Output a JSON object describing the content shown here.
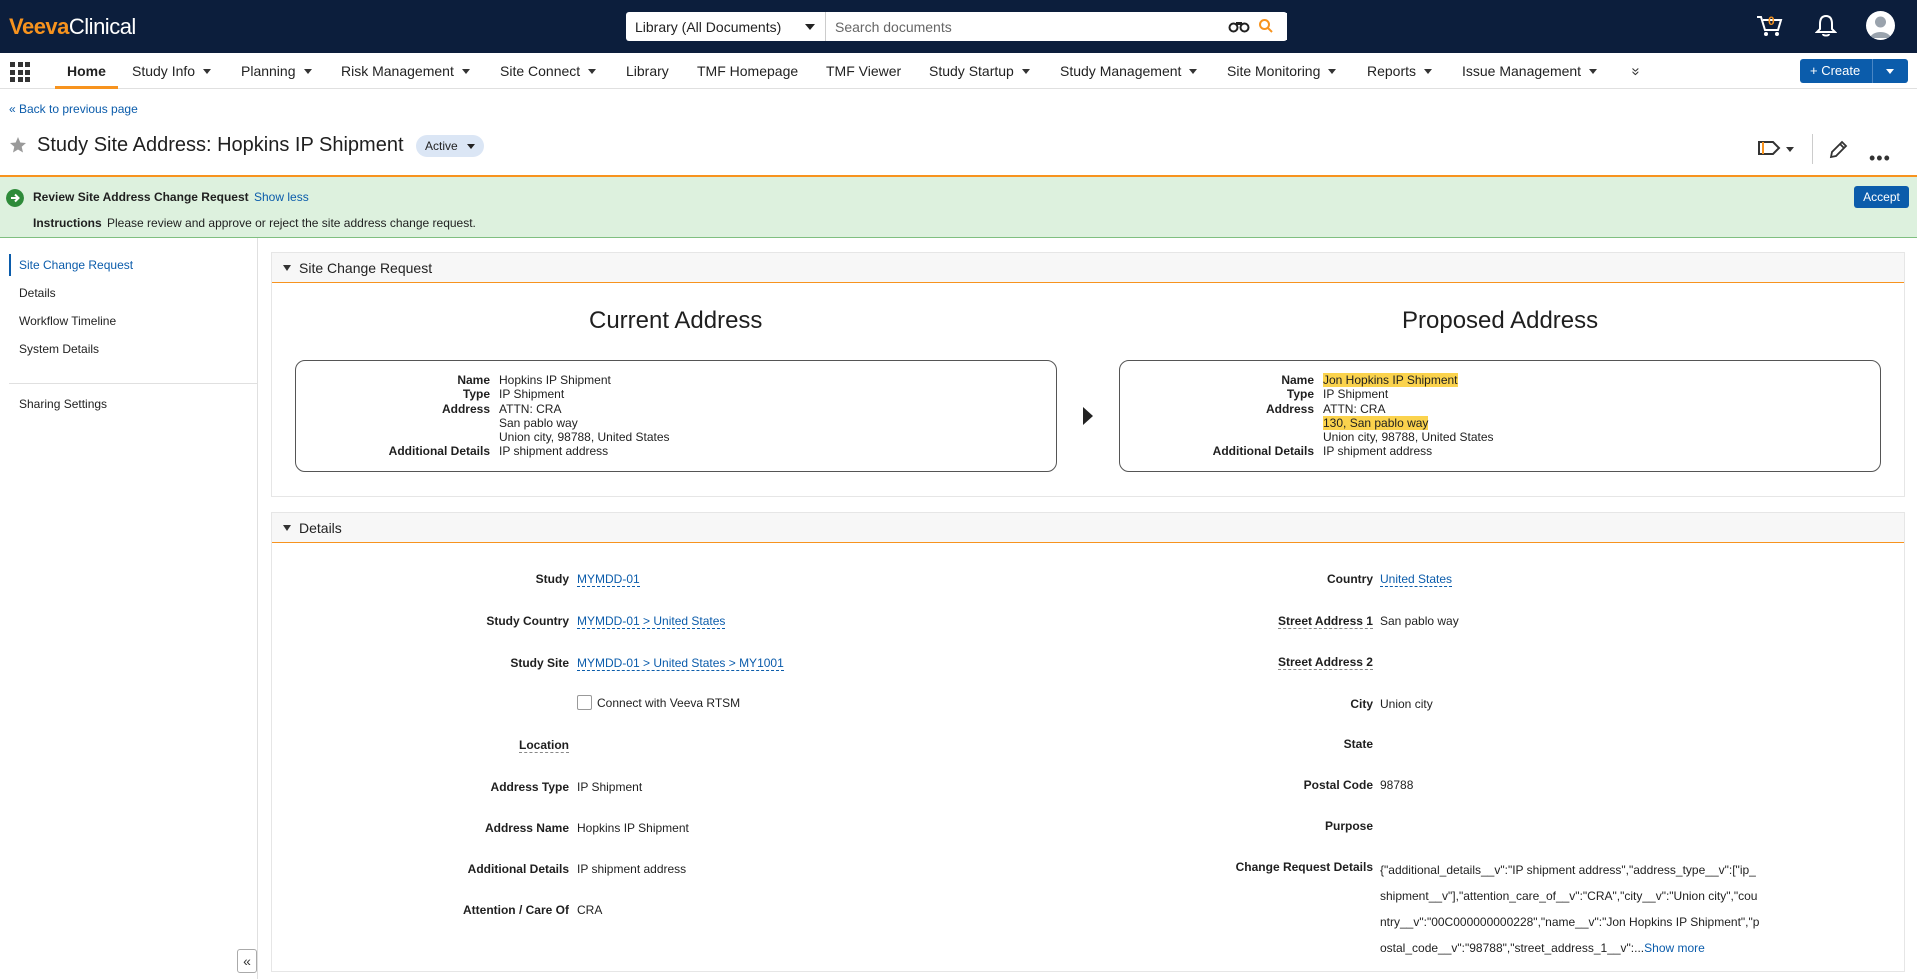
{
  "header": {
    "logo_brand": "Veeva",
    "logo_product": "Clinical",
    "search_scope": "Library (All Documents)",
    "search_placeholder": "Search documents",
    "cart_count": "0"
  },
  "nav": {
    "items": [
      {
        "label": "Home",
        "active": true
      },
      {
        "label": "Study Info",
        "dropdown": true
      },
      {
        "label": "Planning",
        "dropdown": true
      },
      {
        "label": "Risk Management",
        "dropdown": true
      },
      {
        "label": "Site Connect",
        "dropdown": true
      },
      {
        "label": "Library"
      },
      {
        "label": "TMF Homepage"
      },
      {
        "label": "TMF Viewer"
      },
      {
        "label": "Study Startup",
        "dropdown": true
      },
      {
        "label": "Study Management",
        "dropdown": true
      },
      {
        "label": "Site Monitoring",
        "dropdown": true
      },
      {
        "label": "Reports",
        "dropdown": true
      },
      {
        "label": "Issue Management",
        "dropdown": true
      }
    ],
    "more_glyph": "»",
    "create_label": "+ Create"
  },
  "page": {
    "back_link": "« Back to previous page",
    "title": "Study Site Address: Hopkins IP Shipment",
    "status": "Active"
  },
  "task": {
    "title": "Review Site Address Change Request",
    "show_less": "Show less",
    "instructions_label": "Instructions",
    "instructions_text": "Please review and approve or reject the site address change request.",
    "accept_label": "Accept"
  },
  "sidenav": {
    "items": [
      "Site Change Request",
      "Details",
      "Workflow Timeline",
      "System Details"
    ],
    "sharing": "Sharing Settings",
    "collapse_glyph": "«"
  },
  "site_change_request": {
    "section_title": "Site Change Request",
    "current": {
      "heading": "Current Address",
      "name_label": "Name",
      "name": "Hopkins IP Shipment",
      "type_label": "Type",
      "type": "IP Shipment",
      "address_label": "Address",
      "address_line1": "ATTN: CRA",
      "address_line2": "San pablo way",
      "address_line3": "Union city,  98788, United States",
      "additional_label": "Additional Details",
      "additional": "IP shipment address"
    },
    "proposed": {
      "heading": "Proposed Address",
      "name_label": "Name",
      "name": "Jon Hopkins IP Shipment",
      "type_label": "Type",
      "type": "IP Shipment",
      "address_label": "Address",
      "address_line1": "ATTN: CRA",
      "address_line2": "130, San pablo way",
      "address_line3": "Union city,  98788, United States",
      "additional_label": "Additional Details",
      "additional": "IP shipment address"
    }
  },
  "details": {
    "section_title": "Details",
    "left": {
      "study_label": "Study",
      "study": "MYMDD-01",
      "study_country_label": "Study Country",
      "study_country": "MYMDD-01 > United States",
      "study_site_label": "Study Site",
      "study_site": "MYMDD-01 > United States > MY1001",
      "rtsm_label": "Connect with Veeva RTSM",
      "location_label": "Location",
      "address_type_label": "Address Type",
      "address_type": "IP Shipment",
      "address_name_label": "Address Name",
      "address_name": "Hopkins IP Shipment",
      "additional_label": "Additional Details",
      "additional": "IP shipment address",
      "attention_label": "Attention / Care Of",
      "attention": "CRA"
    },
    "right": {
      "country_label": "Country",
      "country": "United States",
      "street1_label": "Street Address 1",
      "street1": "San pablo way",
      "street2_label": "Street Address 2",
      "city_label": "City",
      "city": "Union city",
      "state_label": "State",
      "postal_label": "Postal Code",
      "postal": "98788",
      "purpose_label": "Purpose",
      "change_label": "Change Request Details",
      "change_text": "{\"additional_details__v\":\"IP shipment address\",\"address_type__v\":[\"ip_shipment__v\"],\"attention_care_of__v\":\"CRA\",\"city__v\":\"Union city\",\"country__v\":\"00C000000000228\",\"name__v\":\"Jon Hopkins IP Shipment\",\"postal_code__v\":\"98788\",\"street_address_1__v\":...",
      "show_more": "Show more"
    }
  }
}
